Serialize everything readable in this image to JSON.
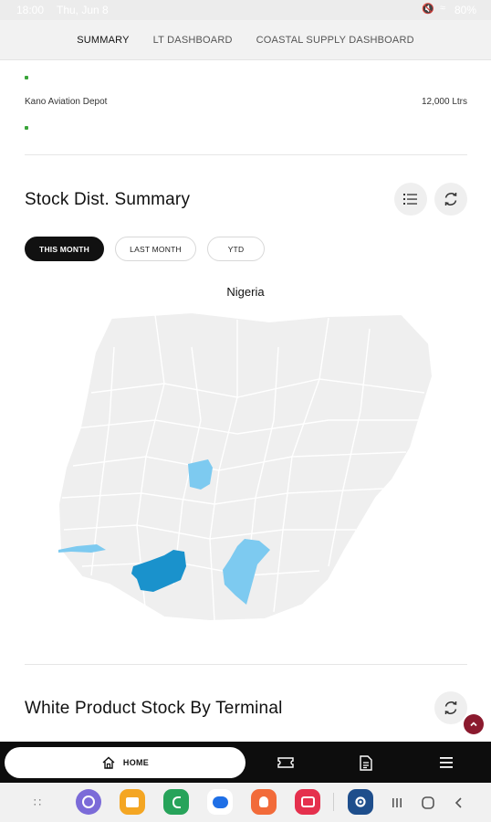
{
  "status_bar": {
    "time": "18:00",
    "date": "Thu, Jun 8",
    "battery": "80%"
  },
  "tabs": [
    {
      "label": "SUMMARY",
      "active": true
    },
    {
      "label": "LT DASHBOARD",
      "active": false
    },
    {
      "label": "COASTAL SUPPLY DASHBOARD",
      "active": false
    }
  ],
  "depot": {
    "name": "Kano Aviation Depot",
    "volume": "12,000 Ltrs"
  },
  "stock_dist": {
    "title": "Stock Dist. Summary",
    "filters": [
      {
        "label": "THIS MONTH",
        "active": true
      },
      {
        "label": "LAST MONTH",
        "active": false
      },
      {
        "label": "YTD",
        "active": false
      }
    ],
    "map_title": "Nigeria",
    "colors": {
      "base": "#efefef",
      "light": "#7dcaf0",
      "dark": "#1a92cc"
    }
  },
  "white_product": {
    "title": "White Product Stock By Terminal"
  },
  "bottom_nav": {
    "home_label": "HOME"
  },
  "colors": {
    "accent": "#111111",
    "scroll_button": "#8b1a2e",
    "depot_dot": "#3aa53a"
  }
}
